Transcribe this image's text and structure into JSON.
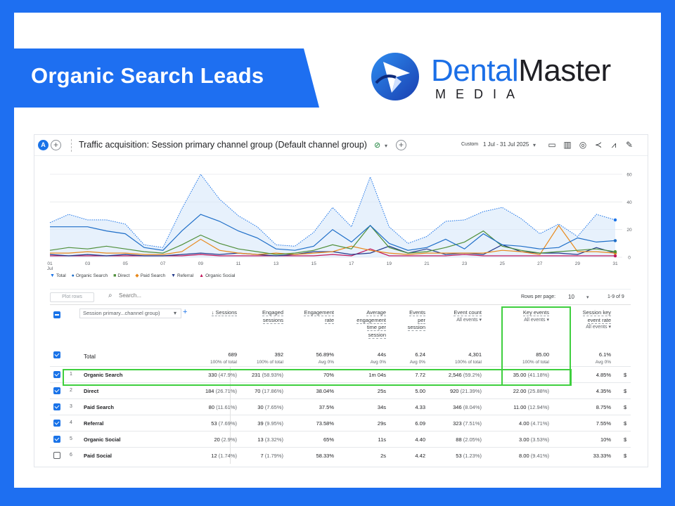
{
  "banner": {
    "title": "Organic Search Leads"
  },
  "logo": {
    "word_primary": "Dental",
    "word_secondary": "Master",
    "sub": "MEDIA",
    "colors": {
      "primary": "#1b6fe7",
      "dark": "#1f1f24"
    }
  },
  "header": {
    "avatar_letter": "A",
    "report_title": "Traffic acquisition: Session primary channel group (Default channel group)",
    "custom_label": "Custom",
    "date_range": "1 Jul - 31 Jul 2025",
    "icons": [
      "compare-icon",
      "customize-report-icon",
      "insights-icon",
      "share-icon",
      "trend-icon",
      "edit-icon"
    ]
  },
  "chart_data": {
    "type": "line",
    "x_labels": [
      "01 Jul",
      "03",
      "05",
      "07",
      "09",
      "11",
      "13",
      "15",
      "17",
      "19",
      "21",
      "23",
      "25",
      "27",
      "29",
      "31"
    ],
    "y_ticks": [
      0,
      20,
      40,
      60
    ],
    "ylim": [
      0,
      65
    ],
    "x": [
      1,
      2,
      3,
      4,
      5,
      6,
      7,
      8,
      9,
      10,
      11,
      12,
      13,
      14,
      15,
      16,
      17,
      18,
      19,
      20,
      21,
      22,
      23,
      24,
      25,
      26,
      27,
      28,
      29,
      30,
      31
    ],
    "series": [
      {
        "name": "Total",
        "color": "#1a73e8",
        "dashed": true,
        "area": true,
        "values": [
          25,
          31,
          27,
          27,
          24,
          9,
          7,
          35,
          60,
          42,
          30,
          22,
          9,
          8,
          18,
          36,
          22,
          58,
          22,
          10,
          15,
          26,
          27,
          33,
          36,
          28,
          17,
          24,
          15,
          31,
          27,
          23,
          18
        ]
      },
      {
        "name": "Organic Search",
        "color": "#1e6ec8",
        "values": [
          22,
          22,
          22,
          19,
          17,
          7,
          5,
          19,
          31,
          26,
          19,
          14,
          6,
          5,
          8,
          20,
          11,
          23,
          10,
          5,
          7,
          13,
          6,
          17,
          9,
          8,
          6,
          7,
          14,
          11,
          12,
          10
        ]
      },
      {
        "name": "Direct",
        "color": "#4f8f3a",
        "values": [
          5,
          7,
          6,
          8,
          6,
          4,
          3,
          9,
          16,
          10,
          6,
          4,
          2,
          3,
          5,
          9,
          6,
          23,
          7,
          3,
          4,
          7,
          11,
          19,
          8,
          5,
          3,
          4,
          5,
          6,
          4,
          4
        ]
      },
      {
        "name": "Paid Search",
        "color": "#e8891b",
        "values": [
          3,
          3,
          4,
          3,
          3,
          2,
          2,
          4,
          13,
          5,
          3,
          2,
          3,
          2,
          3,
          4,
          8,
          5,
          3,
          2,
          3,
          3,
          3,
          3,
          5,
          4,
          2,
          23,
          4,
          4,
          3,
          4
        ]
      },
      {
        "name": "Referral",
        "color": "#233a8b",
        "values": [
          2,
          1,
          2,
          1,
          2,
          1,
          1,
          2,
          3,
          2,
          3,
          2,
          1,
          2,
          4,
          4,
          2,
          3,
          8,
          3,
          6,
          2,
          3,
          2,
          9,
          4,
          3,
          3,
          2,
          7,
          3,
          2
        ]
      },
      {
        "name": "Organic Social",
        "color": "#c2185b",
        "values": [
          1,
          1,
          1,
          1,
          1,
          1,
          1,
          1,
          2,
          1,
          1,
          1,
          1,
          1,
          1,
          2,
          1,
          6,
          1,
          1,
          1,
          1,
          2,
          1,
          1,
          1,
          1,
          1,
          1,
          1,
          1,
          1
        ]
      }
    ]
  },
  "toolbar": {
    "plot_rows": "Plot rows",
    "search_placeholder": "Search...",
    "rows_per_page_label": "Rows per page:",
    "rows_per_page": "10",
    "pager": "1-9 of 9"
  },
  "table": {
    "dimension_select": "Session primary...channel group)",
    "columns": [
      {
        "label_lines": [
          "↓ Sessions"
        ],
        "sub": ""
      },
      {
        "label_lines": [
          "Engaged",
          "sessions"
        ],
        "sub": ""
      },
      {
        "label_lines": [
          "Engagement",
          "rate"
        ],
        "sub": ""
      },
      {
        "label_lines": [
          "Average",
          "engagement",
          "time per",
          "session"
        ],
        "sub": ""
      },
      {
        "label_lines": [
          "Events",
          "per",
          "session"
        ],
        "sub": ""
      },
      {
        "label_lines": [
          "Event count"
        ],
        "sub": "All events ▾"
      },
      {
        "label_lines": [
          "Key events"
        ],
        "sub": "All events ▾"
      },
      {
        "label_lines": [
          "Session key",
          "event rate"
        ],
        "sub": "All events ▾"
      }
    ],
    "totals": {
      "label": "Total",
      "values": [
        "689",
        "392",
        "56.89%",
        "44s",
        "6.24",
        "4,301",
        "85.00",
        "6.1%"
      ],
      "notes": [
        "100% of total",
        "100% of total",
        "Avg 0%",
        "Avg 0%",
        "Avg 0%",
        "100% of total",
        "100% of total",
        "Avg 0%"
      ]
    },
    "rows": [
      {
        "idx": "1",
        "name": "Organic Search",
        "checked": true,
        "cells": [
          [
            "330",
            "(47.9%)"
          ],
          [
            "231",
            "(58.93%)"
          ],
          [
            "70%",
            ""
          ],
          [
            "1m 04s",
            ""
          ],
          [
            "7.72",
            ""
          ],
          [
            "2,546",
            "(59.2%)"
          ],
          [
            "35.00",
            "(41.18%)"
          ],
          [
            "4.85%",
            ""
          ]
        ]
      },
      {
        "idx": "2",
        "name": "Direct",
        "checked": true,
        "cells": [
          [
            "184",
            "(26.71%)"
          ],
          [
            "70",
            "(17.86%)"
          ],
          [
            "38.04%",
            ""
          ],
          [
            "25s",
            ""
          ],
          [
            "5.00",
            ""
          ],
          [
            "920",
            "(21.39%)"
          ],
          [
            "22.00",
            "(25.88%)"
          ],
          [
            "4.35%",
            ""
          ]
        ]
      },
      {
        "idx": "3",
        "name": "Paid Search",
        "checked": true,
        "cells": [
          [
            "80",
            "(11.61%)"
          ],
          [
            "30",
            "(7.65%)"
          ],
          [
            "37.5%",
            ""
          ],
          [
            "34s",
            ""
          ],
          [
            "4.33",
            ""
          ],
          [
            "346",
            "(8.04%)"
          ],
          [
            "11.00",
            "(12.94%)"
          ],
          [
            "8.75%",
            ""
          ]
        ]
      },
      {
        "idx": "4",
        "name": "Referral",
        "checked": true,
        "cells": [
          [
            "53",
            "(7.69%)"
          ],
          [
            "39",
            "(9.95%)"
          ],
          [
            "73.58%",
            ""
          ],
          [
            "29s",
            ""
          ],
          [
            "6.09",
            ""
          ],
          [
            "323",
            "(7.51%)"
          ],
          [
            "4.00",
            "(4.71%)"
          ],
          [
            "7.55%",
            ""
          ]
        ]
      },
      {
        "idx": "5",
        "name": "Organic Social",
        "checked": true,
        "cells": [
          [
            "20",
            "(2.9%)"
          ],
          [
            "13",
            "(3.32%)"
          ],
          [
            "65%",
            ""
          ],
          [
            "11s",
            ""
          ],
          [
            "4.40",
            ""
          ],
          [
            "88",
            "(2.05%)"
          ],
          [
            "3.00",
            "(3.53%)"
          ],
          [
            "10%",
            ""
          ]
        ]
      },
      {
        "idx": "6",
        "name": "Paid Social",
        "checked": false,
        "cells": [
          [
            "12",
            "(1.74%)"
          ],
          [
            "7",
            "(1.79%)"
          ],
          [
            "58.33%",
            ""
          ],
          [
            "2s",
            ""
          ],
          [
            "4.42",
            ""
          ],
          [
            "53",
            "(1.23%)"
          ],
          [
            "8.00",
            "(9.41%)"
          ],
          [
            "33.33%",
            ""
          ]
        ]
      }
    ],
    "trailing_cell": "$"
  },
  "highlight": {
    "color": "#3ecf3e"
  }
}
